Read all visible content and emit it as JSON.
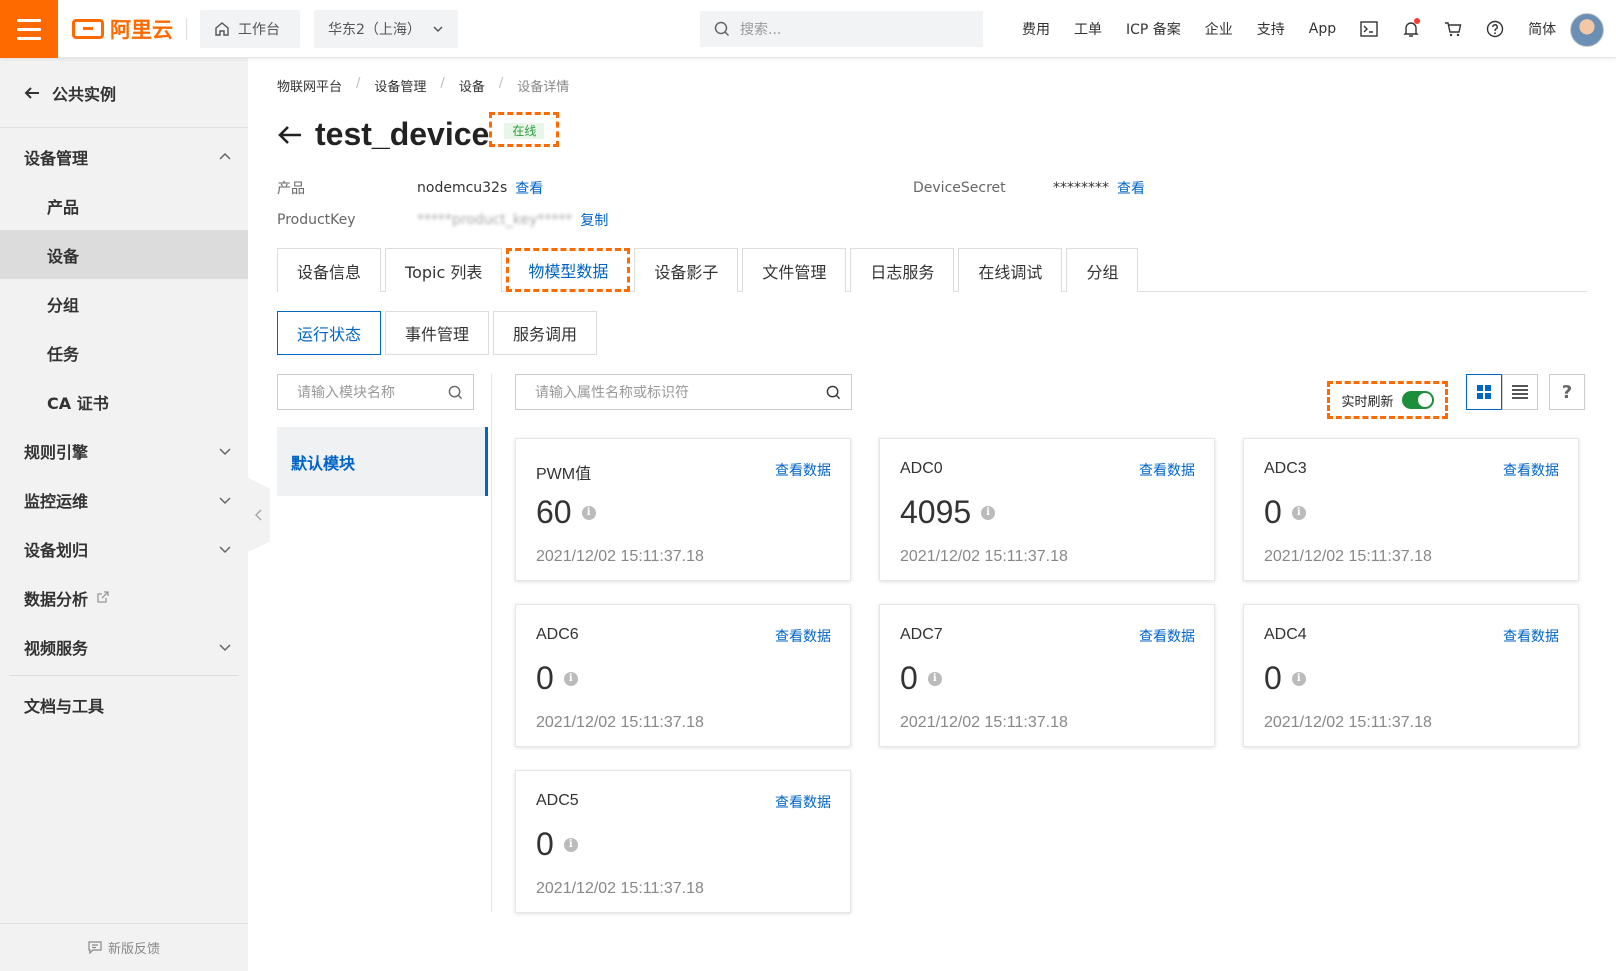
{
  "topbar": {
    "brand": "阿里云",
    "workbench": "工作台",
    "region": "华东2（上海）",
    "search_placeholder": "搜索...",
    "nav": [
      "费用",
      "工单",
      "ICP 备案",
      "企业",
      "支持",
      "App"
    ],
    "lang": "简体",
    "brand_color": "#ff6a00"
  },
  "sidebar": {
    "back_label": "公共实例",
    "groups": {
      "device_mgmt": "设备管理",
      "rules": "规则引擎",
      "monitor": "监控运维",
      "assign": "设备划归",
      "analytics": "数据分析",
      "video": "视频服务",
      "docs": "文档与工具"
    },
    "sub_items": [
      "产品",
      "设备",
      "分组",
      "任务",
      "CA 证书"
    ],
    "feedback": "新版反馈"
  },
  "breadcrumb": [
    "物联网平台",
    "设备管理",
    "设备",
    "设备详情"
  ],
  "device": {
    "name": "test_device",
    "status": "在线",
    "product_label": "产品",
    "product_value": "nodemcu32s",
    "view_label": "查看",
    "secret_label": "DeviceSecret",
    "secret_value": "********",
    "key_label": "ProductKey",
    "key_value": "*****product_key*****",
    "copy_label": "复制"
  },
  "tabs": [
    "设备信息",
    "Topic 列表",
    "物模型数据",
    "设备影子",
    "文件管理",
    "日志服务",
    "在线调试",
    "分组"
  ],
  "subtabs": [
    "运行状态",
    "事件管理",
    "服务调用"
  ],
  "module_search_placeholder": "请输入模块名称",
  "prop_search_placeholder": "请输入属性名称或标识符",
  "module": "默认模块",
  "realtime_label": "实时刷新",
  "help_label": "?",
  "cards": [
    {
      "name": "PWM值",
      "value": "60",
      "time": "2021/12/02 15:11:37.18",
      "link": "查看数据"
    },
    {
      "name": "ADC0",
      "value": "4095",
      "time": "2021/12/02 15:11:37.18",
      "link": "查看数据"
    },
    {
      "name": "ADC3",
      "value": "0",
      "time": "2021/12/02 15:11:37.18",
      "link": "查看数据"
    },
    {
      "name": "ADC6",
      "value": "0",
      "time": "2021/12/02 15:11:37.18",
      "link": "查看数据"
    },
    {
      "name": "ADC7",
      "value": "0",
      "time": "2021/12/02 15:11:37.18",
      "link": "查看数据"
    },
    {
      "name": "ADC4",
      "value": "0",
      "time": "2021/12/02 15:11:37.18",
      "link": "查看数据"
    },
    {
      "name": "ADC5",
      "value": "0",
      "time": "2021/12/02 15:11:37.18",
      "link": "查看数据"
    }
  ]
}
